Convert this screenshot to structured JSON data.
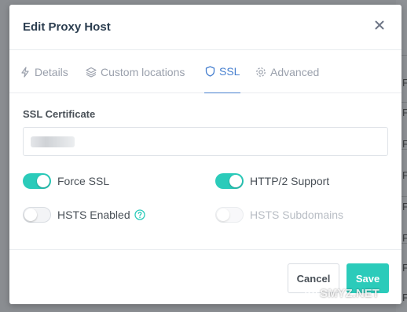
{
  "modal": {
    "title": "Edit Proxy Host"
  },
  "tabs": [
    {
      "label": "Details",
      "icon": "lightning-icon",
      "active": false
    },
    {
      "label": "Custom locations",
      "icon": "layers-icon",
      "active": false
    },
    {
      "label": "SSL",
      "icon": "shield-icon",
      "active": true
    },
    {
      "label": "Advanced",
      "icon": "gear-icon",
      "active": false
    }
  ],
  "ssl": {
    "certificate_label": "SSL Certificate",
    "certificate_value": "",
    "force_ssl": {
      "label": "Force SSL",
      "enabled": true
    },
    "http2": {
      "label": "HTTP/2 Support",
      "enabled": true
    },
    "hsts": {
      "label": "HSTS Enabled",
      "enabled": false
    },
    "hsts_subdomains": {
      "label": "HSTS Subdomains",
      "enabled": false,
      "disabled": true
    }
  },
  "footer": {
    "cancel_label": "Cancel",
    "save_label": "Save"
  },
  "background": {
    "row_letters": [
      "F",
      "F",
      "F",
      "F",
      "F",
      "F",
      "F",
      "F"
    ]
  },
  "watermark": {
    "text": "SMYZ.NET",
    "icon": "smiley-icon"
  },
  "colors": {
    "accent": "#2bcbba",
    "tab_active": "#467fcf",
    "title": "#2c3e50"
  }
}
